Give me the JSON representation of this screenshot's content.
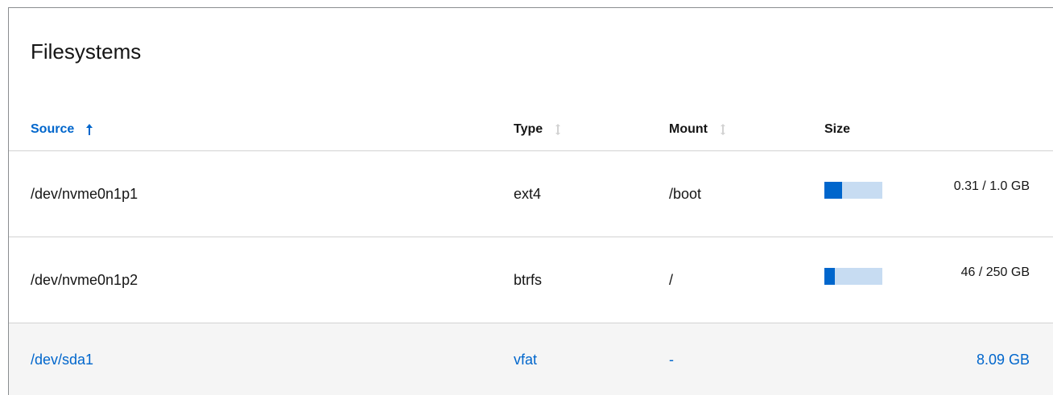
{
  "title": "Filesystems",
  "columns": {
    "source": "Source",
    "type": "Type",
    "mount": "Mount",
    "size": "Size"
  },
  "sort": {
    "column": "source",
    "direction": "ascending"
  },
  "rows": [
    {
      "source": "/dev/nvme0n1p1",
      "type": "ext4",
      "mount": "/boot",
      "usage_fraction": 0.31,
      "size_text": "0.31 / 1.0 GB"
    },
    {
      "source": "/dev/nvme0n1p2",
      "type": "btrfs",
      "mount": "/",
      "usage_fraction": 0.184,
      "size_text": "46 / 250 GB"
    },
    {
      "source": "/dev/sda1",
      "type": "vfat",
      "mount": "-",
      "size_text": "8.09 GB",
      "selected": true
    }
  ],
  "colors": {
    "accent": "#0066cc",
    "bar_track": "#c7dcf2",
    "selected_row_bg": "#f5f5f5"
  },
  "icons": {
    "sorted_ascending": "arrow-up-icon",
    "sortable": "sort-updown-icon"
  }
}
